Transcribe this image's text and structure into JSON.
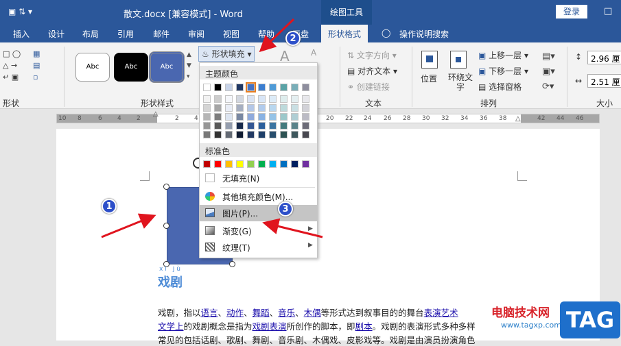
{
  "titlebar": {
    "title": "散文.docx [兼容模式]  -  Word",
    "tools_tab": "绘图工具",
    "login": "登录",
    "quick_access": "▣ ⇅ ▾"
  },
  "tabs": [
    "插入",
    "设计",
    "布局",
    "引用",
    "邮件",
    "审阅",
    "视图",
    "帮助",
    "画盘",
    "形状格式",
    "操作说明搜索"
  ],
  "ribbon": {
    "shape_fill": "形状填充",
    "text_direction": "文字方向",
    "align_text": "对齐文本",
    "create_link": "创建链接",
    "position": "位置",
    "wrap_text": "环绕文字",
    "bring_forward": "上移一层",
    "send_backward": "下移一层",
    "selection_pane": "选择窗格",
    "height": "2.96 厘",
    "width": "2.51 厘",
    "style_labels": [
      "Abc",
      "Abc",
      "Abc"
    ],
    "groups": {
      "insert_shapes": "形状",
      "shape_styles": "形状样式",
      "text": "文本",
      "arrange": "排列",
      "size": "大小"
    }
  },
  "ruler_numbers": [
    "10",
    "8",
    "6",
    "4",
    "2",
    "2",
    "4",
    "6",
    "20",
    "22",
    "24",
    "26",
    "28",
    "30",
    "32",
    "34",
    "36",
    "38",
    "40",
    "42",
    "44",
    "46"
  ],
  "dropdown": {
    "theme_colors_header": "主题颜色",
    "standard_colors_header": "标准色",
    "no_fill": "无填充(N)",
    "more_colors": "其他填充颜色(M)...",
    "picture": "图片(P)...",
    "gradient": "渐变(G)",
    "texture": "纹理(T)",
    "theme_top": [
      "#ffffff",
      "#000000",
      "#e7e6e6",
      "#44546a",
      "#4472c4",
      "#ed7d31",
      "#a5a5a5",
      "#ffc000",
      "#5b9bd5",
      "#70ad47"
    ],
    "theme_top_actual": [
      "#ffffff",
      "#000000",
      "#c7d3e8",
      "#203864",
      "#4472c4",
      "#3b7ed0",
      "#4f9bd7",
      "#5aa3a6",
      "#79aeb8",
      "#8e8e9e"
    ],
    "standard": [
      "#c00000",
      "#ff0000",
      "#ffc000",
      "#ffff00",
      "#92d050",
      "#00b050",
      "#00b0f0",
      "#0070c0",
      "#002060",
      "#7030a0"
    ]
  },
  "document": {
    "heading": "戏剧",
    "pinyin": "xì jù",
    "line1_pre": "戏剧，指以",
    "line1_links": [
      "语言",
      "动作",
      "舞蹈",
      "音乐",
      "木偶"
    ],
    "line1_post": "等形式达到叙事目的的舞台",
    "line1_tail": "表演艺术",
    "line2_link1": "文学上",
    "line2_mid": "的戏剧概念是指为",
    "line2_link2": "戏剧表演",
    "line2_mid2": "所创作的脚本，即",
    "line2_link3": "剧本",
    "line2_tail": "。戏剧的表演形式多种多样",
    "line3": "常见的包括话剧、歌剧、舞剧、音乐剧、木偶戏、皮影戏等。戏剧是由演员扮演角色"
  },
  "markers": [
    "1",
    "2",
    "3"
  ],
  "watermark": {
    "site_cn": "电脑技术网",
    "site_url": "www.tagxp.com",
    "logo": "TAG"
  },
  "colors": {
    "word_blue": "#2b579a",
    "shape_fill": "#4a67b0",
    "arrow_red": "#e0141e"
  }
}
